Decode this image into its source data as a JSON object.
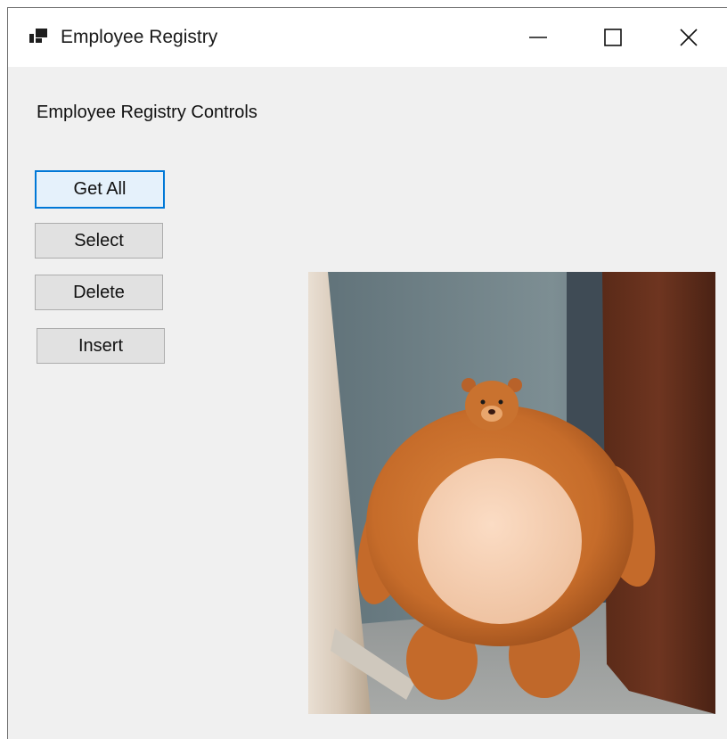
{
  "window": {
    "title": "Employee Registry"
  },
  "main": {
    "heading": "Employee Registry Controls",
    "buttons": {
      "get_all": "Get All",
      "select": "Select",
      "delete": "Delete",
      "insert": "Insert"
    }
  },
  "icons": {
    "app": "app-window-icon",
    "minimize": "minimize-icon",
    "maximize": "maximize-icon",
    "close": "close-icon"
  },
  "colors": {
    "focus_accent": "#0078d7",
    "window_bg": "#f0f0f0",
    "button_bg": "#e1e1e1"
  }
}
